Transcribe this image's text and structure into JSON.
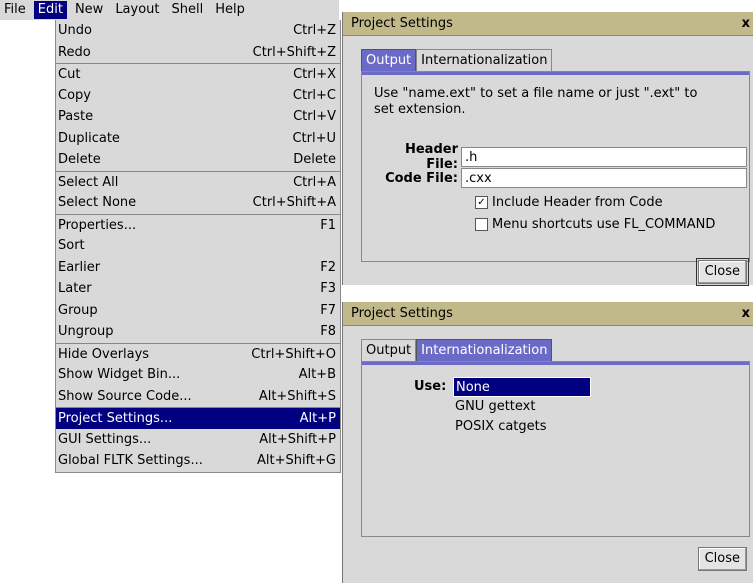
{
  "menubar": {
    "items": [
      {
        "label": "File",
        "selected": false
      },
      {
        "label": "Edit",
        "selected": true
      },
      {
        "label": "New",
        "selected": false
      },
      {
        "label": "Layout",
        "selected": false
      },
      {
        "label": "Shell",
        "selected": false
      },
      {
        "label": "Help",
        "selected": false
      }
    ]
  },
  "edit_menu": {
    "items": [
      {
        "label": "Undo",
        "shortcut": "Ctrl+Z",
        "sep": false,
        "selected": false
      },
      {
        "label": "Redo",
        "shortcut": "Ctrl+Shift+Z",
        "sep": false,
        "selected": false
      },
      {
        "label": "Cut",
        "shortcut": "Ctrl+X",
        "sep": true,
        "selected": false
      },
      {
        "label": "Copy",
        "shortcut": "Ctrl+C",
        "sep": false,
        "selected": false
      },
      {
        "label": "Paste",
        "shortcut": "Ctrl+V",
        "sep": false,
        "selected": false
      },
      {
        "label": "Duplicate",
        "shortcut": "Ctrl+U",
        "sep": false,
        "selected": false
      },
      {
        "label": "Delete",
        "shortcut": "Delete",
        "sep": false,
        "selected": false
      },
      {
        "label": "Select All",
        "shortcut": "Ctrl+A",
        "sep": true,
        "selected": false
      },
      {
        "label": "Select None",
        "shortcut": "Ctrl+Shift+A",
        "sep": false,
        "selected": false
      },
      {
        "label": "Properties...",
        "shortcut": "F1",
        "sep": true,
        "selected": false
      },
      {
        "label": "Sort",
        "shortcut": "",
        "sep": false,
        "selected": false
      },
      {
        "label": "Earlier",
        "shortcut": "F2",
        "sep": false,
        "selected": false
      },
      {
        "label": "Later",
        "shortcut": "F3",
        "sep": false,
        "selected": false
      },
      {
        "label": "Group",
        "shortcut": "F7",
        "sep": false,
        "selected": false
      },
      {
        "label": "Ungroup",
        "shortcut": "F8",
        "sep": false,
        "selected": false
      },
      {
        "label": "Hide Overlays",
        "shortcut": "Ctrl+Shift+O",
        "sep": true,
        "selected": false
      },
      {
        "label": "Show Widget Bin...",
        "shortcut": "Alt+B",
        "sep": false,
        "selected": false
      },
      {
        "label": "Show Source Code...",
        "shortcut": "Alt+Shift+S",
        "sep": false,
        "selected": false
      },
      {
        "label": "Project Settings...",
        "shortcut": "Alt+P",
        "sep": true,
        "selected": true
      },
      {
        "label": "GUI Settings...",
        "shortcut": "Alt+Shift+P",
        "sep": false,
        "selected": false
      },
      {
        "label": "Global FLTK Settings...",
        "shortcut": "Alt+Shift+G",
        "sep": false,
        "selected": false
      }
    ]
  },
  "dialog1": {
    "title": "Project Settings",
    "close_glyph": "x",
    "tabs": [
      "Output",
      "Internationalization"
    ],
    "hint": "Use \"name.ext\" to set a file name or just \".ext\" to set extension.",
    "header_label": "Header File:",
    "header_value": ".h",
    "code_label": "Code File:",
    "code_value": ".cxx",
    "check1_label": "Include Header from Code",
    "check1_checked": true,
    "check1_mark": "✓",
    "check2_label": "Menu shortcuts use FL_COMMAND",
    "close_label": "Close"
  },
  "dialog2": {
    "title": "Project Settings",
    "close_glyph": "x",
    "tabs": [
      "Output",
      "Internationalization"
    ],
    "use_label": "Use:",
    "options": [
      "None",
      "GNU gettext",
      "POSIX catgets"
    ],
    "selected_option": "None",
    "close_label": "Close"
  },
  "colors": {
    "selection": "#000080",
    "active_tab": "#6b6bc7",
    "titlebar": "#c2b98a",
    "face": "#d9d9d9"
  }
}
